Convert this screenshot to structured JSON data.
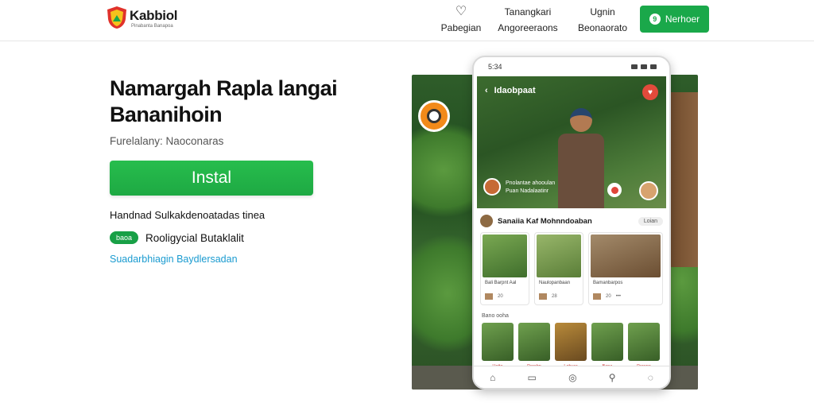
{
  "header": {
    "brand_name": "Kabbiol",
    "brand_tagline": "Pinabanta Banapoa",
    "nav": [
      {
        "top": "♡",
        "bottom": "Pabegian"
      },
      {
        "top": "Tanangkari",
        "bottom": "Angoreeraons"
      },
      {
        "top": "Ugnin",
        "bottom": "Beonaorato"
      }
    ],
    "cta_label": "Nerhoer",
    "cta_icon": "9"
  },
  "hero": {
    "title": "Namargah Rapla langai Bananihoin",
    "subtitle": "Furelalany: Naoconaras",
    "install_label": "Instal",
    "feature_line": "Handnad Sulkakdenoatadas tinea",
    "badge": "baoa",
    "badge_text": "Rooligycial Butaklalit",
    "link": "Suadarbhiagin Baydlersadan"
  },
  "phone": {
    "status_time": "5:34",
    "video_title": "Idaobpaat",
    "video_caption_1": "Pnolantae ahooulan",
    "video_caption_2": "Puan Nadalaatinr",
    "section_title": "Sanaiia Kaf Mohnndoaban",
    "section_pill": "Loian",
    "cards": [
      {
        "meta": "Bali Barpnt Aal",
        "foot": "20"
      },
      {
        "meta": "Naulopanbaan",
        "foot": "28"
      },
      {
        "meta": "Bamanbarpos",
        "foot": "20"
      }
    ],
    "stories_label": "Bano ooha",
    "stories": [
      "Hotta",
      "Parabn",
      "Lobuar",
      "Bana",
      "Pareno"
    ],
    "tabs": [
      "⌂",
      "▭",
      "◎",
      "⚲",
      "◌"
    ]
  },
  "colors": {
    "accent_green": "#1aa84a",
    "link_blue": "#1a9bd0",
    "alert_red": "#e24a3b"
  }
}
